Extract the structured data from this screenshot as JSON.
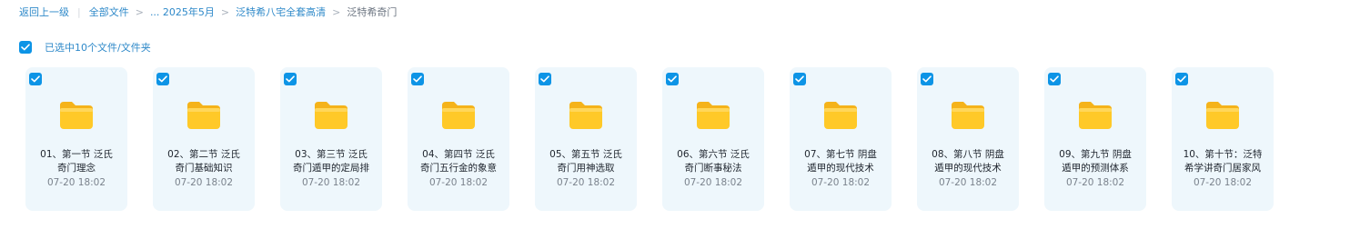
{
  "breadcrumb": {
    "back": "返回上一级",
    "all_files": "全部文件",
    "separator": ">",
    "path": [
      "... 2025年5月",
      "泛特希八宅全套高清"
    ],
    "current": "泛特希奇门"
  },
  "selection": {
    "text": "已选中10个文件/文件夹",
    "checked": true
  },
  "colors": {
    "accent": "#0d94e6",
    "link": "#2e89c9",
    "card_bg": "#eef7fc",
    "folder": "#ffc928"
  },
  "files": [
    {
      "line1": "01、第一节 泛氏",
      "line2": "奇门理念",
      "date": "07-20 18:02",
      "icon": "folder-icon",
      "checked": true
    },
    {
      "line1": "02、第二节 泛氏",
      "line2": "奇门基础知识",
      "date": "07-20 18:02",
      "icon": "folder-icon",
      "checked": true
    },
    {
      "line1": "03、第三节 泛氏",
      "line2": "奇门遁甲的定局排",
      "date": "07-20 18:02",
      "icon": "folder-icon",
      "checked": true
    },
    {
      "line1": "04、第四节 泛氏",
      "line2": "奇门五行金的象意",
      "date": "07-20 18:02",
      "icon": "folder-icon",
      "checked": true
    },
    {
      "line1": "05、第五节 泛氏",
      "line2": "奇门用神选取",
      "date": "07-20 18:02",
      "icon": "folder-icon",
      "checked": true
    },
    {
      "line1": "06、第六节 泛氏",
      "line2": "奇门断事秘法",
      "date": "07-20 18:02",
      "icon": "folder-icon",
      "checked": true
    },
    {
      "line1": "07、第七节 阴盘",
      "line2": "遁甲的现代技术",
      "date": "07-20 18:02",
      "icon": "folder-icon",
      "checked": true
    },
    {
      "line1": "08、第八节 阴盘",
      "line2": "遁甲的现代技术",
      "date": "07-20 18:02",
      "icon": "folder-icon",
      "checked": true
    },
    {
      "line1": "09、第九节 阴盘",
      "line2": "遁甲的预测体系",
      "date": "07-20 18:02",
      "icon": "folder-icon",
      "checked": true
    },
    {
      "line1": "10、第十节：泛特",
      "line2": "希学讲奇门居家风",
      "date": "07-20 18:02",
      "icon": "folder-icon",
      "checked": true
    }
  ]
}
